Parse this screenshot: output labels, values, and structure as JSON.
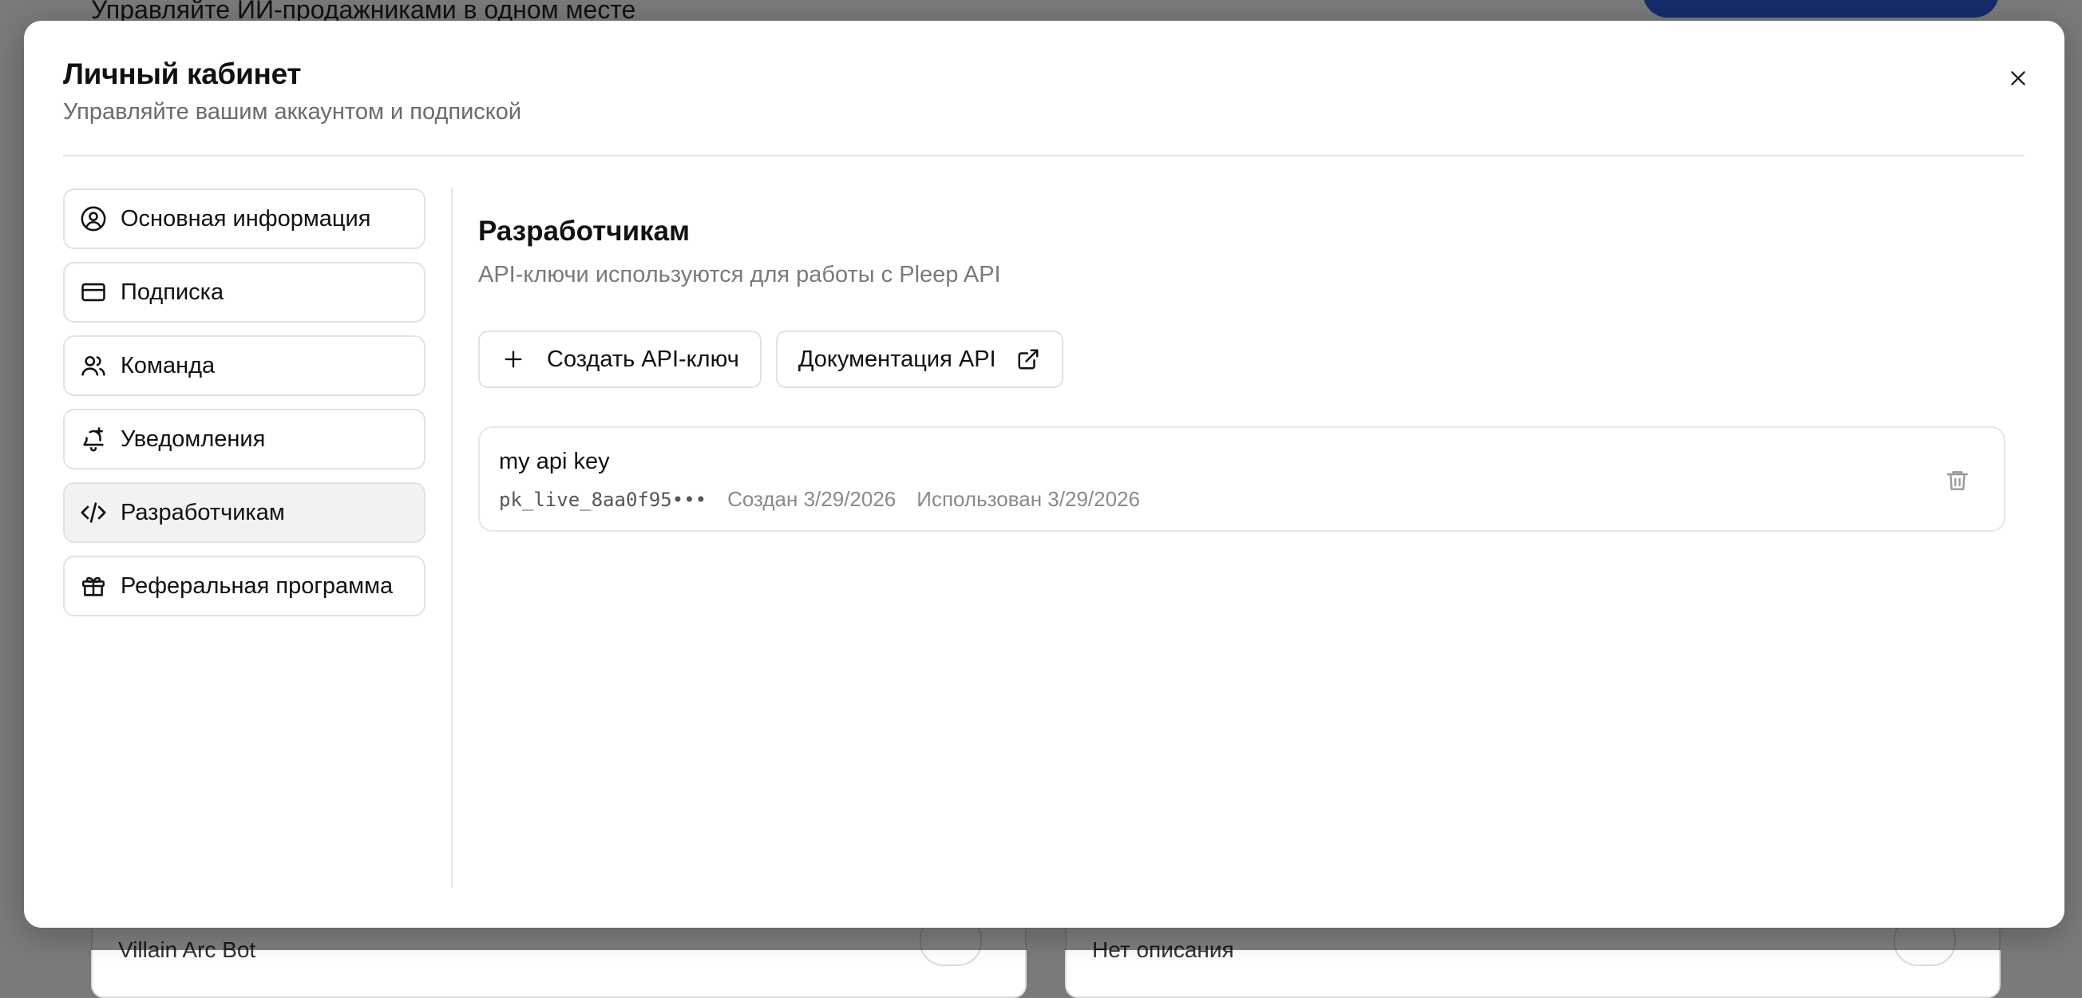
{
  "background": {
    "top_text": "Управляйте ИИ-продажниками в одном месте",
    "card_left_text": "Villain Arc Bot",
    "card_right_text": "Нет описания"
  },
  "modal": {
    "title": "Личный кабинет",
    "subtitle": "Управляйте вашим аккаунтом и подпиской",
    "close_icon": "x-icon"
  },
  "sidebar": {
    "items": [
      {
        "label": "Основная информация",
        "icon": "user-circle-icon",
        "active": false
      },
      {
        "label": "Подписка",
        "icon": "credit-card-icon",
        "active": false
      },
      {
        "label": "Команда",
        "icon": "users-icon",
        "active": false
      },
      {
        "label": "Уведомления",
        "icon": "bell-plus-icon",
        "active": false
      },
      {
        "label": "Разработчикам",
        "icon": "code-icon",
        "active": true
      },
      {
        "label": "Реферальная программа",
        "icon": "gift-icon",
        "active": false
      }
    ]
  },
  "developers": {
    "title": "Разработчикам",
    "subtitle": "API-ключи используются для работы с Pleep API",
    "create_key_label": "Создать API-ключ",
    "docs_label": "Документация API",
    "api_keys": [
      {
        "name": "my api key",
        "token": "pk_live_8aa0f95•••",
        "created": "Создан 3/29/2026",
        "used": "Использован 3/29/2026"
      }
    ]
  },
  "colors": {
    "accent_bg_button": "#2a5bd7",
    "border": "#e2e2e2",
    "active_item_bg": "#f2f2f2",
    "muted_text": "#7a7a7a"
  }
}
